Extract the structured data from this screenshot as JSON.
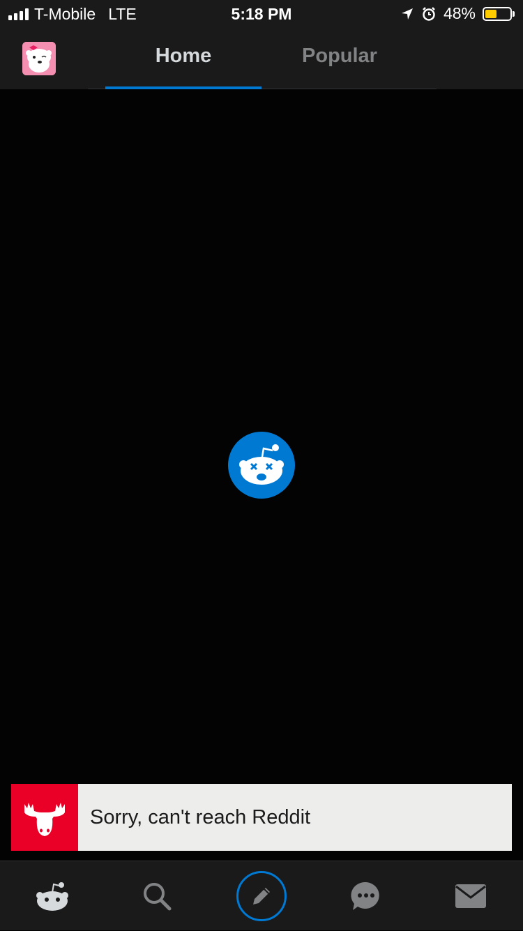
{
  "status_bar": {
    "carrier": "T-Mobile",
    "network": "LTE",
    "time": "5:18 PM",
    "battery_percent": "48%",
    "battery_level": 0.48,
    "icons": [
      "signal-bars-icon",
      "location-arrow-icon",
      "alarm-icon",
      "battery-icon"
    ]
  },
  "header": {
    "avatar_icon": "snoo-avatar-pink",
    "tabs": [
      {
        "label": "Home",
        "active": true
      },
      {
        "label": "Popular",
        "active": false
      }
    ],
    "active_color": "#0079d3"
  },
  "main": {
    "error_icon": "snoo-dead-icon",
    "error_icon_color": "#0079d3"
  },
  "toast": {
    "message": "Sorry, can't reach Reddit",
    "icon": "moose-icon",
    "icon_bg_color": "#ea0027"
  },
  "bottom_nav": {
    "items": [
      "home-snoo-icon",
      "search-icon",
      "compose-pencil-icon",
      "chat-icon",
      "inbox-mail-icon"
    ]
  }
}
